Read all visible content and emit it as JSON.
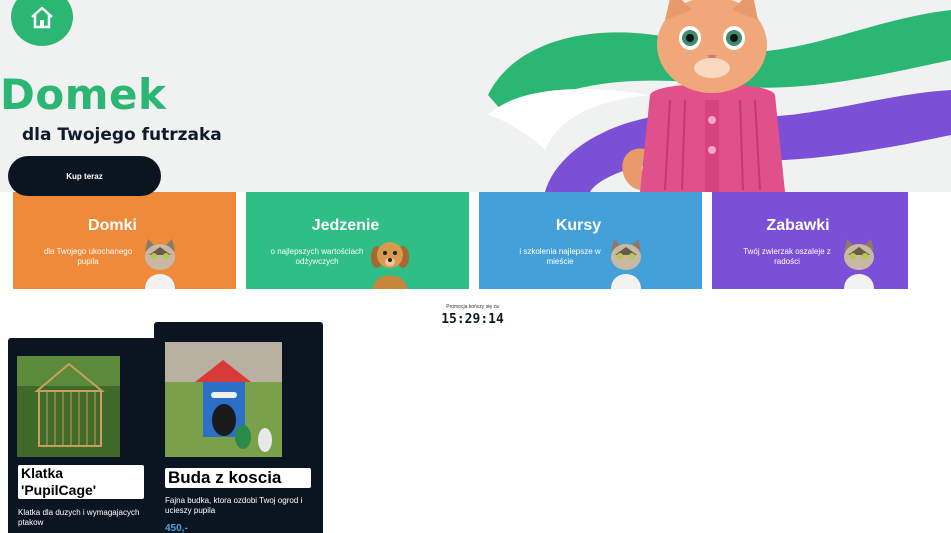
{
  "hero": {
    "title": "Domek",
    "subtitle": "dla Twojego futrzaka",
    "buy_label": "Kup teraz"
  },
  "categories": [
    {
      "title": "Domki",
      "desc": "dla Twojego ukochanego pupila",
      "color": "#ee8a3a",
      "pet": "cat-icon"
    },
    {
      "title": "Jedzenie",
      "desc": "o najlepszych wartościach odżywczych",
      "color": "#2ebe86",
      "pet": "dog-icon"
    },
    {
      "title": "Kursy",
      "desc": "i szkolenia najlepsze w mieście",
      "color": "#44a0d8",
      "pet": "cat-icon"
    },
    {
      "title": "Zabawki",
      "desc": "Twój zwierzak oszaleje z radości",
      "color": "#7b4fd6",
      "pet": "cat-icon"
    }
  ],
  "promo": {
    "label": "Promocja kończy się za",
    "time": "15:29:14"
  },
  "products": [
    {
      "name": "Klatka 'PupilCage'",
      "desc": "Klatka dla duzych i wymagajacych ptakow"
    },
    {
      "name": "Buda z koscia",
      "desc": "Fajna budka, ktora ozdobi Twoj ogrod i ucieszy pupila",
      "price": "450,-"
    }
  ],
  "colors": {
    "accent_green": "#2bb673",
    "dark_navy": "#0b1522",
    "purple": "#7b4fd6",
    "price_blue": "#4aa3df"
  }
}
